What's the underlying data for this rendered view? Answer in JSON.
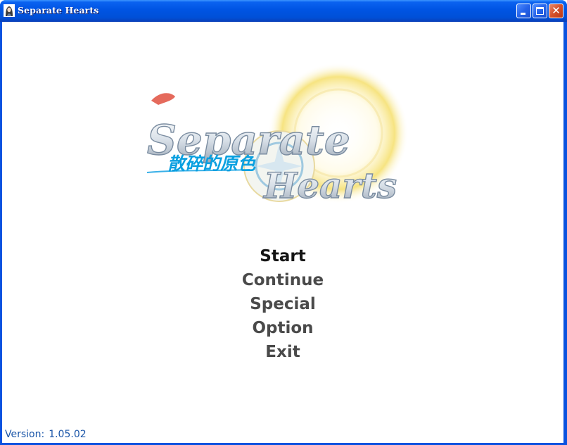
{
  "window": {
    "title": "Separate Hearts",
    "icon": "girl-portrait-app-icon",
    "controls": {
      "minimize": "minimize-icon",
      "maximize": "maximize-icon",
      "close": "close-icon"
    }
  },
  "logo": {
    "line1": "Separate",
    "line2": "Hearts",
    "subtitle": "散碎的原色",
    "colors": {
      "title_fill": "#e4eaf0",
      "title_stroke": "#7a8ca0",
      "title_red": "#e05040",
      "subtitle": "#0aa0e0",
      "sun": "#f6e27a"
    }
  },
  "menu": {
    "items": [
      {
        "label": "Start",
        "active": true
      },
      {
        "label": "Continue",
        "active": false
      },
      {
        "label": "Special",
        "active": false
      },
      {
        "label": "Option",
        "active": false
      },
      {
        "label": "Exit",
        "active": false
      }
    ]
  },
  "version": {
    "label": "Version:",
    "value": "1.05.02"
  }
}
